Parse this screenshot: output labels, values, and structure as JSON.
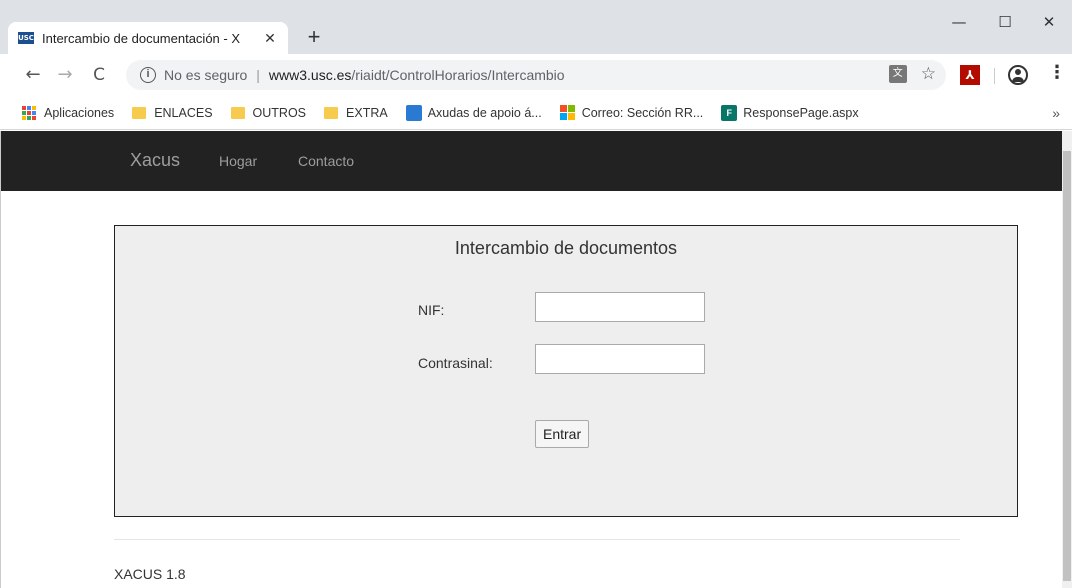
{
  "browser": {
    "tab": {
      "favicon_text": "USC",
      "title": "Intercambio de documentación - X"
    },
    "window_controls": {
      "minimize": "—",
      "maximize": "☐",
      "close": "✕"
    },
    "toolbar": {
      "back": "←",
      "forward": "→",
      "reload": "C",
      "security": "No es seguro",
      "url_host": "www3.usc.es",
      "url_path": "/riaidt/ControlHorarios/Intercambio"
    },
    "bookmarks": [
      {
        "label": "Aplicaciones",
        "icon": "apps-grid-icon"
      },
      {
        "label": "ENLACES",
        "icon": "folder-icon"
      },
      {
        "label": "OUTROS",
        "icon": "folder-icon"
      },
      {
        "label": "EXTRA",
        "icon": "folder-icon"
      },
      {
        "label": "Axudas de apoio á...",
        "icon": "bookmark-site-icon"
      },
      {
        "label": "Correo: Sección RR...",
        "icon": "microsoft-icon"
      },
      {
        "label": "ResponsePage.aspx",
        "icon": "forms-icon"
      }
    ],
    "bookmarks_more": "»"
  },
  "page": {
    "navbar": {
      "brand": "Xacus",
      "links": [
        "Hogar",
        "Contacto"
      ]
    },
    "form": {
      "title": "Intercambio de documentos",
      "nif_label": "NIF:",
      "nif_value": "",
      "password_label": "Contrasinal:",
      "password_value": "",
      "submit_label": "Entrar"
    },
    "footer": "XACUS 1.8"
  },
  "colors": {
    "navbar_bg": "#222222",
    "navbar_text": "#9d9d9d",
    "panel_bg": "#eeeeee",
    "folder": "#f7cb4d"
  }
}
